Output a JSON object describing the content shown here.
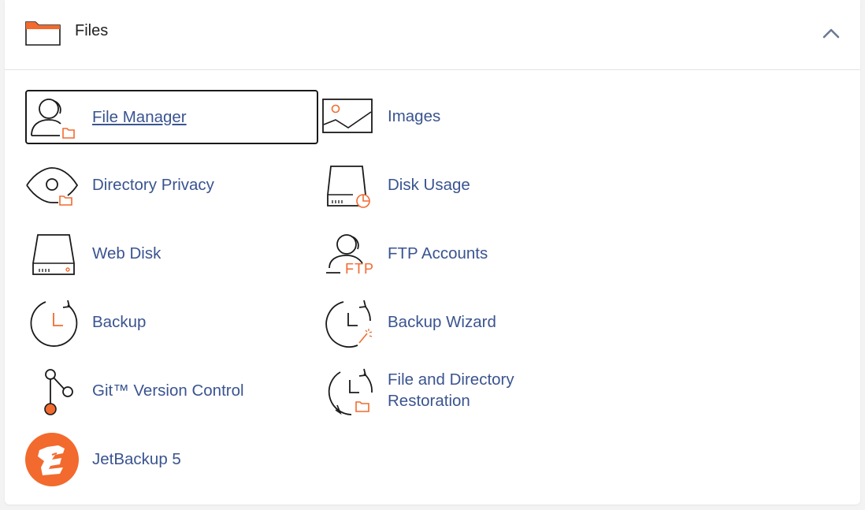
{
  "section": {
    "title": "Files",
    "header_icon": "folder-icon",
    "collapse_icon": "chevron-up-icon"
  },
  "colors": {
    "link": "#3a5490",
    "accent": "#f26a2e",
    "icon_stroke": "#1a1a1a"
  },
  "items": [
    {
      "label": "File Manager",
      "icon": "file-manager-icon",
      "focused": true
    },
    {
      "label": "Images",
      "icon": "images-icon"
    },
    {
      "label": "Directory Privacy",
      "icon": "directory-privacy-icon"
    },
    {
      "label": "Disk Usage",
      "icon": "disk-usage-icon"
    },
    {
      "label": "Web Disk",
      "icon": "web-disk-icon"
    },
    {
      "label": "FTP Accounts",
      "icon": "ftp-accounts-icon",
      "icon_text": "FTP"
    },
    {
      "label": "Backup",
      "icon": "backup-icon"
    },
    {
      "label": "Backup Wizard",
      "icon": "backup-wizard-icon"
    },
    {
      "label": "Git™ Version Control",
      "icon": "git-version-control-icon"
    },
    {
      "label_line1": "File and Directory",
      "label_line2": "Restoration",
      "icon": "file-directory-restoration-icon"
    },
    {
      "label": "JetBackup 5",
      "icon": "jetbackup-icon"
    }
  ]
}
